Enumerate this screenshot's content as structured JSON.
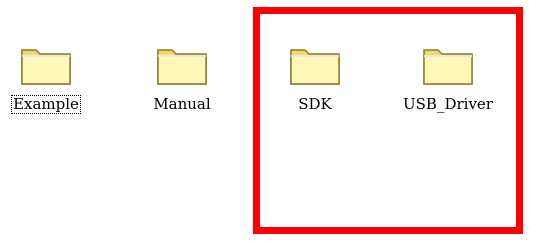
{
  "folders": [
    {
      "name": "Example",
      "icon": "folder-icon",
      "focused": true
    },
    {
      "name": "Manual",
      "icon": "folder-icon",
      "focused": false
    },
    {
      "name": "SDK",
      "icon": "folder-icon",
      "focused": false
    },
    {
      "name": "USB_Driver",
      "icon": "folder-icon",
      "focused": false
    }
  ],
  "colors": {
    "folder_fill": "#fff8b8",
    "folder_shade": "#f4d86a",
    "folder_outline": "#8a7a2a",
    "highlight_border": "#ff0000"
  }
}
